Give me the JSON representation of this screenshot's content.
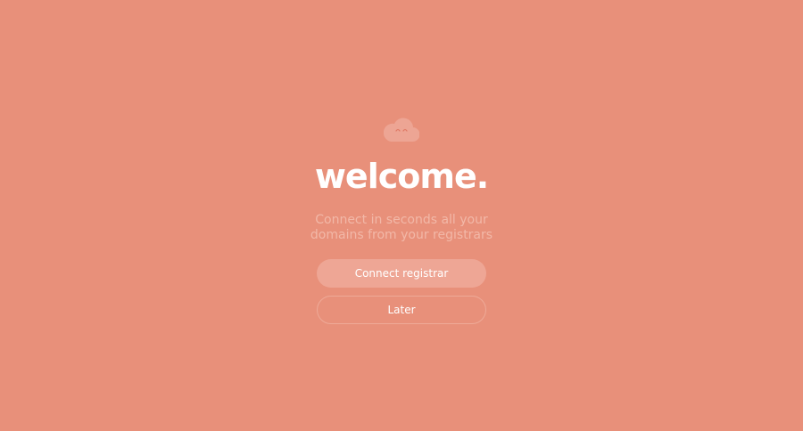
{
  "logo": {
    "icon": "cloud-face-icon"
  },
  "welcome": {
    "title": "welcome.",
    "subtitle_line1": "Connect in seconds all your",
    "subtitle_line2": "domains from your registrars"
  },
  "actions": {
    "primary_label": "Connect registrar",
    "secondary_label": "Later"
  },
  "colors": {
    "background": "#e8907a",
    "primary_button": "#eea695",
    "subtitle": "#f2b8a8",
    "text": "#ffffff"
  }
}
